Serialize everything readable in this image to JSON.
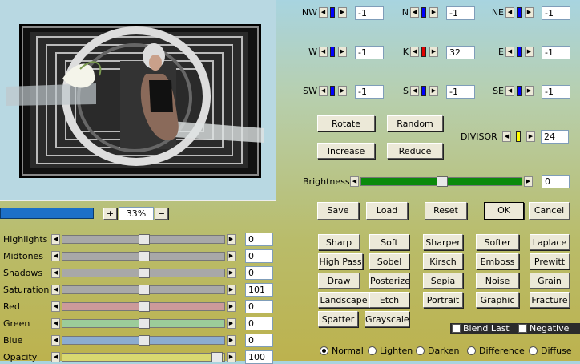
{
  "preview": {
    "zoom": "33%",
    "zoom_in": "+",
    "zoom_out": "−"
  },
  "matrix": [
    {
      "label": "NW",
      "value": "-1",
      "color": "#0000ff"
    },
    {
      "label": "N",
      "value": "-1",
      "color": "#0000ff"
    },
    {
      "label": "NE",
      "value": "-1",
      "color": "#0000ff"
    },
    {
      "label": "W",
      "value": "-1",
      "color": "#0000ff"
    },
    {
      "label": "K",
      "value": "32",
      "color": "#e00000"
    },
    {
      "label": "E",
      "value": "-1",
      "color": "#0000ff"
    },
    {
      "label": "SW",
      "value": "-1",
      "color": "#0000ff"
    },
    {
      "label": "S",
      "value": "-1",
      "color": "#0000ff"
    },
    {
      "label": "SE",
      "value": "-1",
      "color": "#0000ff"
    }
  ],
  "matrix_buttons": {
    "rotate": "Rotate",
    "random": "Random",
    "increase": "Increase",
    "reduce": "Reduce"
  },
  "divisor": {
    "label": "DIVISOR",
    "value": "24",
    "color": "#ffff00"
  },
  "brightness": {
    "label": "Brightness",
    "value": "0"
  },
  "actions": {
    "save": "Save",
    "load": "Load",
    "reset": "Reset",
    "ok": "OK",
    "cancel": "Cancel"
  },
  "adjustments": [
    {
      "label": "Highlights",
      "value": "0",
      "color": "#a8a8a8"
    },
    {
      "label": "Midtones",
      "value": "0",
      "color": "#a8a8a8"
    },
    {
      "label": "Shadows",
      "value": "0",
      "color": "#a8a8a8"
    },
    {
      "label": "Saturation",
      "value": "101",
      "color": "#a8a8a8"
    },
    {
      "label": "Red",
      "value": "0",
      "color": "#cc9a9a"
    },
    {
      "label": "Green",
      "value": "0",
      "color": "#9ccc9a"
    },
    {
      "label": "Blue",
      "value": "0",
      "color": "#8cacd0"
    },
    {
      "label": "Opacity",
      "value": "100",
      "color": "#d8d870"
    }
  ],
  "presets": [
    [
      "Sharp",
      "Soft",
      "Sharper",
      "Softer",
      "Laplace"
    ],
    [
      "High Pass",
      "Sobel",
      "Kirsch",
      "Emboss",
      "Prewitt"
    ],
    [
      "Draw",
      "Posterize",
      "Sepia",
      "Noise",
      "Grain"
    ],
    [
      "Landscape",
      "Etch",
      "Portrait",
      "Graphic",
      "Fracture"
    ],
    [
      "Spatter",
      "Grayscale"
    ]
  ],
  "options": {
    "blend_last": "Blend Last",
    "negative": "Negative"
  },
  "blend_modes": [
    {
      "label": "Normal",
      "selected": true
    },
    {
      "label": "Lighten",
      "selected": false
    },
    {
      "label": "Darken",
      "selected": false
    },
    {
      "label": "Difference",
      "selected": false
    },
    {
      "label": "Diffuse",
      "selected": false
    }
  ]
}
